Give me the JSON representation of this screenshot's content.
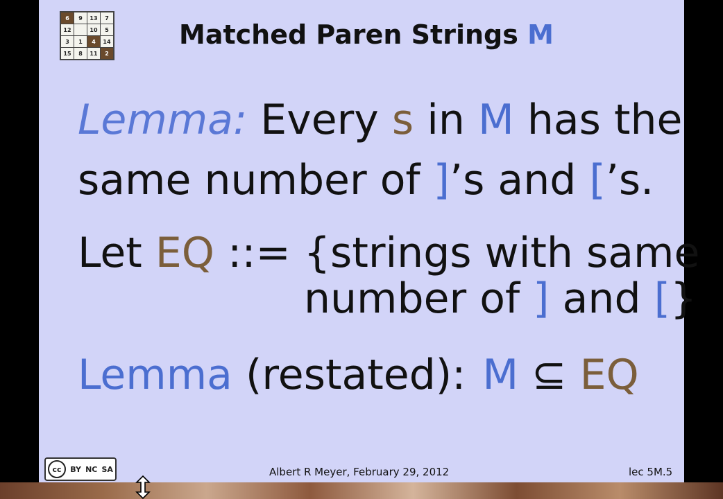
{
  "logo": {
    "cells": [
      "6",
      "9",
      "13",
      "7",
      "12",
      "",
      "10",
      "5",
      "3",
      "1",
      "4",
      "14",
      "15",
      "8",
      "11",
      "2"
    ],
    "dark_indices": [
      0,
      10,
      15
    ]
  },
  "title": {
    "text": "Matched Paren Strings ",
    "symbol": "M"
  },
  "line1": {
    "lemma": "Lemma:",
    "every": " Every ",
    "s": "s",
    "in": " in ",
    "m": "M",
    "rest": " has the"
  },
  "line2": {
    "text": "same number of ",
    "close_bracket": "]",
    "s_and": "’s and ",
    "open_bracket": "[",
    "s_end": "’s."
  },
  "line3": {
    "let": "Let ",
    "eq": "EQ",
    "rest": " ::= {strings with same"
  },
  "line4": {
    "text": "number of ",
    "close_bracket": "]",
    "and": " and ",
    "open_bracket": "[",
    "brace": "}"
  },
  "line5": {
    "lemma": "Lemma",
    "restated": " (restated):",
    "m": "M",
    "subseteq": " ⊆ ",
    "eq": "EQ"
  },
  "footer": {
    "author_date": "Albert R Meyer,   February 29, 2012",
    "page": "lec 5M.5"
  },
  "license": {
    "labels": [
      "BY",
      "NC",
      "SA"
    ]
  },
  "colors": {
    "background": "#d2d4f8",
    "accent_blue": "#4b6ed0",
    "accent_brown": "#7b5e3b"
  },
  "icons": [
    "creative-commons-icon",
    "resize-vertical-cursor-icon"
  ]
}
